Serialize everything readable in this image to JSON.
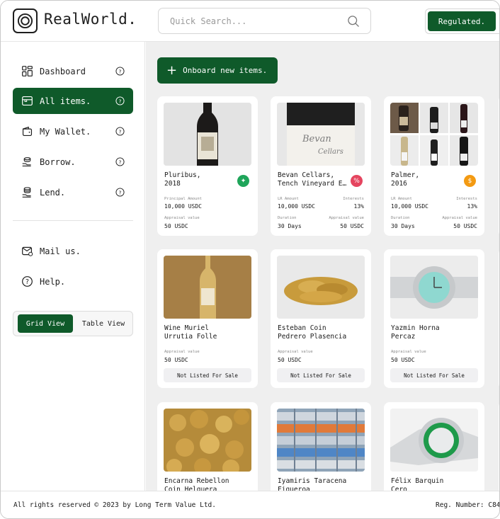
{
  "app": {
    "name": "RealWorld."
  },
  "header": {
    "search_placeholder": "Quick Search...",
    "regulated_label": "Regulated."
  },
  "sidebar": {
    "items": [
      {
        "label": "Dashboard",
        "icon": "dashboard-icon"
      },
      {
        "label": "All items.",
        "icon": "inventory-icon",
        "active": true
      },
      {
        "label": "My Wallet.",
        "icon": "wallet-icon"
      },
      {
        "label": "Borrow.",
        "icon": "borrow-icon"
      },
      {
        "label": "Lend.",
        "icon": "lend-icon"
      }
    ],
    "secondary": [
      {
        "label": "Mail us.",
        "icon": "mail-icon"
      },
      {
        "label": "Help.",
        "icon": "help-icon"
      }
    ],
    "view_toggle": {
      "grid": "Grid View",
      "table": "Table View",
      "selected": "grid"
    }
  },
  "main": {
    "onboard_label": "Onboard new items.",
    "cards": [
      {
        "title": "Pluribus,\n2018",
        "badge": "tag",
        "badge_color": "#1fa55a",
        "principal_label": "Principal Amount",
        "principal_value": "10,000 USDC",
        "appraisal_label": "Appraisal value",
        "appraisal_value": "50 USDC"
      },
      {
        "title": "Bevan Cellars,\nTench Vineyard E…",
        "badge": "%",
        "badge_color": "#e5455f",
        "lr_label": "LR Amount",
        "lr_value": "10,000 USDC",
        "interests_label": "Interests",
        "interests_value": "13%",
        "duration_label": "Duration",
        "duration_value": "30 Days",
        "appraisal_label": "Appraisal value",
        "appraisal_value": "50 USDC"
      },
      {
        "title": "Palmer,\n2016",
        "badge": "bag",
        "badge_color": "#f39a12",
        "lr_label": "LR Amount",
        "lr_value": "10,000 USDC",
        "interests_label": "Interests",
        "interests_value": "13%",
        "duration_label": "Duration",
        "duration_value": "30 Days",
        "appraisal_label": "Appraisal value",
        "appraisal_value": "50 USDC"
      },
      {
        "title": "Wine Muriel\nUrrutia Folle",
        "appraisal_label": "Appraisal value",
        "appraisal_value": "50 USDC",
        "status": "Not Listed For Sale"
      },
      {
        "title": "Esteban Coin\nPedrero Plasencia",
        "appraisal_label": "Appraisal value",
        "appraisal_value": "50 USDC",
        "status": "Not Listed For Sale"
      },
      {
        "title": "Yazmin Horna\nPercaz",
        "appraisal_label": "Appraisal value",
        "appraisal_value": "50 USDC",
        "status": "Not Listed For Sale"
      },
      {
        "title": "Encarna Rebellon\nCoin Helguera"
      },
      {
        "title": "Iyamiris Taracena\nFigueroa"
      },
      {
        "title": "Félix Barquin\nCero"
      }
    ]
  },
  "footer": {
    "copyright": "All rights reserved © 2023 by Long Term Value Ltd.",
    "reg_number": "Reg. Number: C84"
  },
  "colors": {
    "brand": "#0f5a2a",
    "background": "#efefef"
  }
}
